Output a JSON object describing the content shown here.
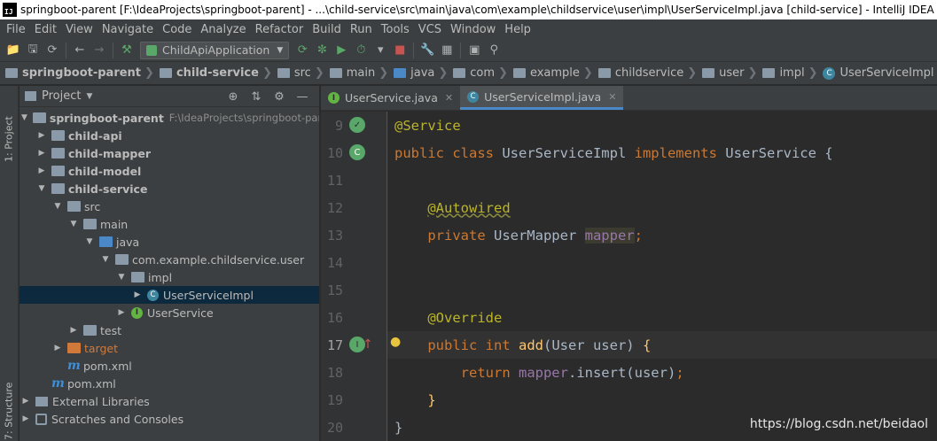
{
  "window": {
    "title": "springboot-parent [F:\\IdeaProjects\\springboot-parent] - ...\\child-service\\src\\main\\java\\com\\example\\childservice\\user\\impl\\UserServiceImpl.java [child-service] - IntelliJ IDEA",
    "app_icon": "IJ"
  },
  "menu": [
    "File",
    "Edit",
    "View",
    "Navigate",
    "Code",
    "Analyze",
    "Refactor",
    "Build",
    "Run",
    "Tools",
    "VCS",
    "Window",
    "Help"
  ],
  "toolbar": {
    "run_config": "ChildApiApplication"
  },
  "breadcrumb": [
    "springboot-parent",
    "child-service",
    "src",
    "main",
    "java",
    "com",
    "example",
    "childservice",
    "user",
    "impl",
    "UserServiceImpl"
  ],
  "side_tabs": {
    "project": "1: Project",
    "structure": "7: Structure"
  },
  "project_panel": {
    "title": "Project",
    "tree": [
      {
        "label": "springboot-parent",
        "extra": "F:\\IdeaProjects\\springboot-par",
        "depth": 0,
        "arrow": "down",
        "icon": "module",
        "bold": true
      },
      {
        "label": "child-api",
        "depth": 1,
        "arrow": "right",
        "icon": "module",
        "bold": true
      },
      {
        "label": "child-mapper",
        "depth": 1,
        "arrow": "right",
        "icon": "module",
        "bold": true
      },
      {
        "label": "child-model",
        "depth": 1,
        "arrow": "right",
        "icon": "module",
        "bold": true
      },
      {
        "label": "child-service",
        "depth": 1,
        "arrow": "down",
        "icon": "module",
        "bold": true
      },
      {
        "label": "src",
        "depth": 2,
        "arrow": "down",
        "icon": "folder"
      },
      {
        "label": "main",
        "depth": 3,
        "arrow": "down",
        "icon": "folder"
      },
      {
        "label": "java",
        "depth": 4,
        "arrow": "down",
        "icon": "src-folder"
      },
      {
        "label": "com.example.childservice.user",
        "depth": 5,
        "arrow": "down",
        "icon": "folder"
      },
      {
        "label": "impl",
        "depth": 6,
        "arrow": "down",
        "icon": "folder"
      },
      {
        "label": "UserServiceImpl",
        "depth": 7,
        "arrow": "right",
        "icon": "class",
        "selected": true
      },
      {
        "label": "UserService",
        "depth": 6,
        "arrow": "right",
        "icon": "interface"
      },
      {
        "label": "test",
        "depth": 3,
        "arrow": "right",
        "icon": "folder"
      },
      {
        "label": "target",
        "depth": 2,
        "arrow": "right",
        "icon": "orange-folder"
      },
      {
        "label": "pom.xml",
        "depth": 2,
        "arrow": "none",
        "icon": "maven"
      },
      {
        "label": "pom.xml",
        "depth": 1,
        "arrow": "none",
        "icon": "maven"
      },
      {
        "label": "External Libraries",
        "depth": 0,
        "arrow": "right",
        "icon": "lib"
      },
      {
        "label": "Scratches and Consoles",
        "depth": 0,
        "arrow": "right",
        "icon": "scratch"
      }
    ]
  },
  "editor": {
    "tabs": [
      {
        "label": "UserService.java",
        "icon": "I",
        "kind": "interface",
        "active": false
      },
      {
        "label": "UserServiceImpl.java",
        "icon": "C",
        "kind": "class",
        "active": true
      }
    ],
    "lines": [
      {
        "num": "9",
        "tokens": [
          {
            "t": "@Service",
            "c": "ann"
          }
        ]
      },
      {
        "num": "10",
        "tokens": [
          {
            "t": "public class ",
            "c": "kw"
          },
          {
            "t": "UserServiceImpl ",
            "c": "cls"
          },
          {
            "t": "implements ",
            "c": "kw"
          },
          {
            "t": "UserService {",
            "c": "cls"
          }
        ]
      },
      {
        "num": "11",
        "tokens": []
      },
      {
        "num": "12",
        "tokens": [
          {
            "t": "    "
          },
          {
            "t": "@Autowired",
            "c": "ann"
          }
        ]
      },
      {
        "num": "13",
        "tokens": [
          {
            "t": "    "
          },
          {
            "t": "private ",
            "c": "kw"
          },
          {
            "t": "UserMapper ",
            "c": "cls"
          },
          {
            "t": "mapper",
            "c": "fld hl"
          },
          {
            "t": ";",
            "c": "kw"
          }
        ]
      },
      {
        "num": "14",
        "tokens": []
      },
      {
        "num": "15",
        "tokens": []
      },
      {
        "num": "16",
        "tokens": [
          {
            "t": "    "
          },
          {
            "t": "@Override",
            "c": "ann"
          }
        ]
      },
      {
        "num": "17",
        "tokens": [
          {
            "t": "    "
          },
          {
            "t": "public int ",
            "c": "kw"
          },
          {
            "t": "add",
            "c": "fn"
          },
          {
            "t": "(User user) ",
            "c": "plain"
          },
          {
            "t": "{",
            "c": "fn"
          }
        ]
      },
      {
        "num": "18",
        "tokens": [
          {
            "t": "        "
          },
          {
            "t": "return ",
            "c": "kw"
          },
          {
            "t": "mapper",
            "c": "fld"
          },
          {
            "t": ".insert(user)",
            "c": "plain"
          },
          {
            "t": ";",
            "c": "kw"
          }
        ]
      },
      {
        "num": "19",
        "tokens": [
          {
            "t": "    "
          },
          {
            "t": "}",
            "c": "fn"
          }
        ]
      },
      {
        "num": "20",
        "tokens": [
          {
            "t": "}",
            "c": "plain"
          }
        ]
      }
    ],
    "current_line": "17"
  },
  "watermark": "https://blog.csdn.net/beidaol",
  "colors": {
    "background": "#2b2b2b",
    "panel": "#3c3f41",
    "keyword": "#cc7832",
    "annotation": "#bbb529",
    "field": "#9876aa",
    "method": "#ffc66d",
    "selection": "#0d293e"
  }
}
